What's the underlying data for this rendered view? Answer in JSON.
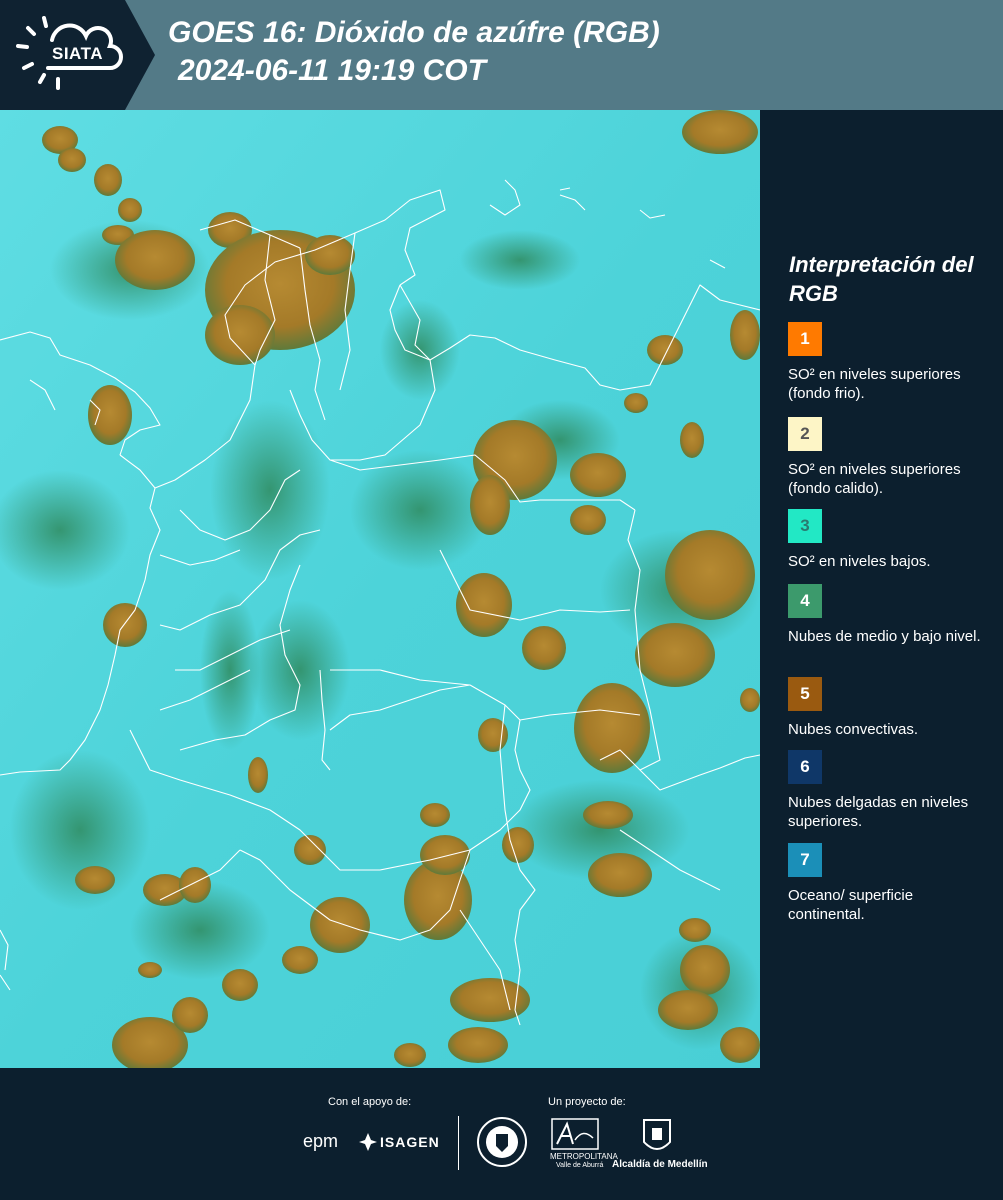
{
  "header": {
    "logo": "SIATA",
    "title_line1": "GOES 16: Dióxido de azúfre (RGB)",
    "title_line2": "2024-06-11 19:19 COT"
  },
  "legend": {
    "title": "Interpretación del RGB",
    "items": [
      {
        "num": "1",
        "color": "#ff7a00",
        "num_color": "#ffffff",
        "text": "SO² en niveles superiores (fondo frio)."
      },
      {
        "num": "2",
        "color": "#fdf5c6",
        "num_color": "#555555",
        "text": "SO² en niveles superiores (fondo calido)."
      },
      {
        "num": "3",
        "color": "#22e8c5",
        "num_color": "#2a7a70",
        "text": "SO² en niveles bajos."
      },
      {
        "num": "4",
        "color": "#3c9a6c",
        "num_color": "#ffffff",
        "text": "Nubes de medio y bajo nivel."
      },
      {
        "num": "5",
        "color": "#9a5a10",
        "num_color": "#ffffff",
        "text": "Nubes convectivas."
      },
      {
        "num": "6",
        "color": "#0f3768",
        "num_color": "#ffffff",
        "text": "Nubes delgadas en niveles superiores."
      },
      {
        "num": "7",
        "color": "#1b8fb8",
        "num_color": "#ffffff",
        "text": "Oceano/ superficie continental."
      }
    ]
  },
  "footer": {
    "support_label": "Con el apoyo de:",
    "project_label": "Un proyecto de:",
    "sponsor1": "epm",
    "sponsor2": "ISAGEN",
    "partner1_line1": "METROPOLITANA",
    "partner1_line2": "Valle de Aburrá",
    "partner2": "Alcaldía de Medellín"
  },
  "colors": {
    "header": "#537a87",
    "background": "#0c1f2e",
    "map_base": "#4fd6db",
    "cloud": "#a07a2a"
  }
}
